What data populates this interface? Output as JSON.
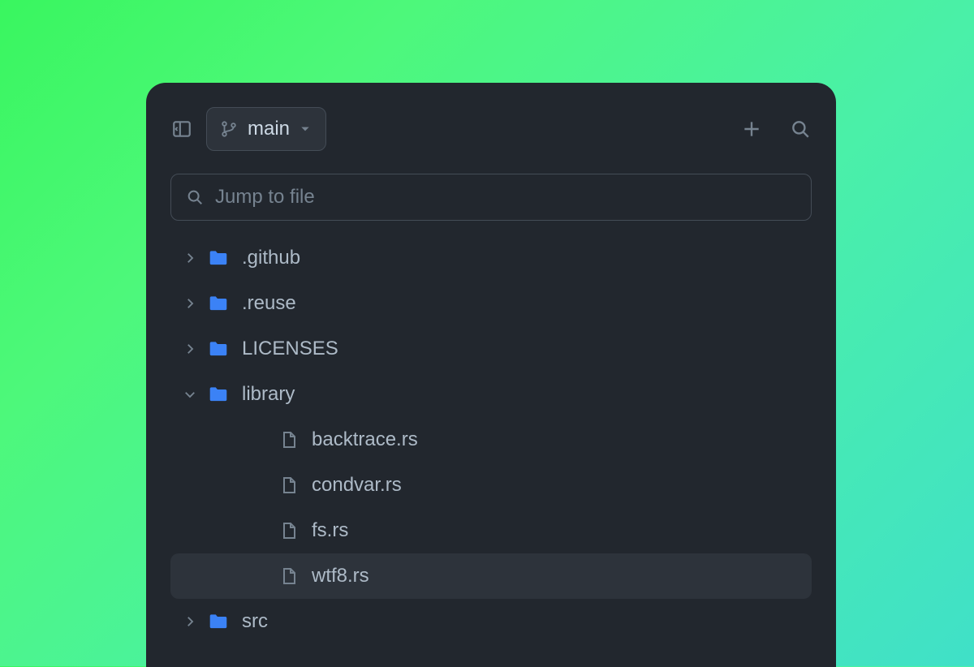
{
  "toolbar": {
    "branch_name": "main"
  },
  "search": {
    "placeholder": "Jump to file"
  },
  "tree": {
    "items": [
      {
        "name": ".github",
        "type": "folder",
        "expanded": false,
        "depth": 0
      },
      {
        "name": ".reuse",
        "type": "folder",
        "expanded": false,
        "depth": 0
      },
      {
        "name": "LICENSES",
        "type": "folder",
        "expanded": false,
        "depth": 0
      },
      {
        "name": "library",
        "type": "folder",
        "expanded": true,
        "depth": 0
      },
      {
        "name": "backtrace.rs",
        "type": "file",
        "depth": 1
      },
      {
        "name": "condvar.rs",
        "type": "file",
        "depth": 1
      },
      {
        "name": "fs.rs",
        "type": "file",
        "depth": 1
      },
      {
        "name": "wtf8.rs",
        "type": "file",
        "depth": 1,
        "selected": true
      },
      {
        "name": "src",
        "type": "folder",
        "expanded": false,
        "depth": 0
      }
    ]
  }
}
